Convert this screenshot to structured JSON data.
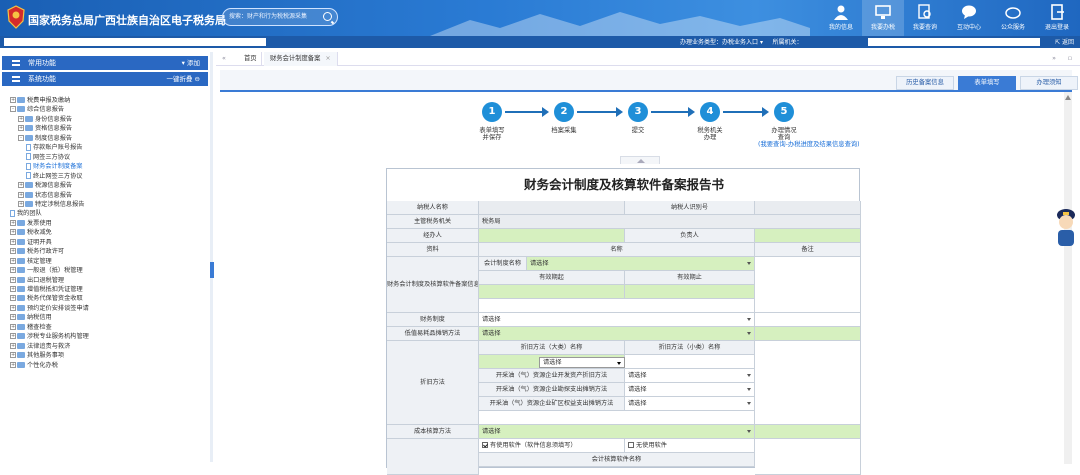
{
  "header": {
    "title": "国家税务总局广西壮族自治区电子税务局",
    "search_placeholder": "搜索：财产和行为税税源采集",
    "nav": [
      "我的信息",
      "我要办税",
      "我要查询",
      "互动中心",
      "公众服务",
      "退出登录"
    ]
  },
  "bar2": {
    "business_type_label": "办理业务类型：",
    "business_type_value": "办税业务入口",
    "agency_label": "所属机关：",
    "back": "返回"
  },
  "sidebar": {
    "common": "常用功能",
    "common_action": "添加",
    "all": "系统功能",
    "all_action": "一键折叠",
    "tree": [
      {
        "l": "税费申报及缴纳",
        "pm": "+",
        "d": 0
      },
      {
        "l": "综合信息报告",
        "pm": "-",
        "d": 0
      },
      {
        "l": "身份信息报告",
        "pm": "+",
        "d": 1
      },
      {
        "l": "资格信息报告",
        "pm": "+",
        "d": 1
      },
      {
        "l": "制度信息报告",
        "pm": "-",
        "d": 1
      },
      {
        "l": "存款账户账号报告",
        "pm": "",
        "d": 2
      },
      {
        "l": "网签三方协议",
        "pm": "",
        "d": 2
      },
      {
        "l": "财务会计制度备案",
        "pm": "",
        "d": 2,
        "sel": true
      },
      {
        "l": "终止网签三方协议",
        "pm": "",
        "d": 2
      },
      {
        "l": "税源信息报告",
        "pm": "+",
        "d": 1
      },
      {
        "l": "状态信息报告",
        "pm": "+",
        "d": 1
      },
      {
        "l": "特定涉税信息报告",
        "pm": "+",
        "d": 1
      },
      {
        "l": "我的团队",
        "pm": "",
        "d": 0
      },
      {
        "l": "发票使用",
        "pm": "+",
        "d": 0
      },
      {
        "l": "税收减免",
        "pm": "+",
        "d": 0
      },
      {
        "l": "证明开具",
        "pm": "+",
        "d": 0
      },
      {
        "l": "税务行政许可",
        "pm": "+",
        "d": 0
      },
      {
        "l": "核定管理",
        "pm": "+",
        "d": 0
      },
      {
        "l": "一般退（抵）税管理",
        "pm": "+",
        "d": 0
      },
      {
        "l": "出口退税管理",
        "pm": "+",
        "d": 0
      },
      {
        "l": "增值税抵扣凭证管理",
        "pm": "+",
        "d": 0
      },
      {
        "l": "税务代保管资金收取",
        "pm": "+",
        "d": 0
      },
      {
        "l": "预约定价安排谈签申请",
        "pm": "+",
        "d": 0
      },
      {
        "l": "纳税信用",
        "pm": "+",
        "d": 0
      },
      {
        "l": "稽查检查",
        "pm": "+",
        "d": 0
      },
      {
        "l": "涉税专业服务机构管理",
        "pm": "+",
        "d": 0
      },
      {
        "l": "法律追责与救济",
        "pm": "+",
        "d": 0
      },
      {
        "l": "其他服务事项",
        "pm": "+",
        "d": 0
      },
      {
        "l": "个性化办税",
        "pm": "+",
        "d": 0
      }
    ]
  },
  "tabs": {
    "home": "首页",
    "current": "财务会计制度备案"
  },
  "subtabs": [
    "历史备案信息",
    "表单填写",
    "办理须知"
  ],
  "steps": [
    {
      "n": "1",
      "label": "表单填写\n并保存"
    },
    {
      "n": "2",
      "label": "档案采集"
    },
    {
      "n": "3",
      "label": "提交"
    },
    {
      "n": "4",
      "label": "税务机关\n办理"
    },
    {
      "n": "5",
      "label": "办理情况\n查询"
    }
  ],
  "step5_link": "(我要查询-办税进度及结果信息查询)",
  "form": {
    "title": "财务会计制度及核算软件备案报告书",
    "taxpayer_name": "纳税人名称",
    "taxpayer_id": "纳税人识别号",
    "authority": "主管税务机关",
    "authority_value": "税务局",
    "handler": "经办人",
    "responsible": "负责人",
    "material": "资料",
    "name_col": "名称",
    "remark": "备注",
    "acct_info": "财务会计制度及核算软件备案信息",
    "acct_system_name": "会计制度名称",
    "select": "请选择",
    "valid_from": "有效期起",
    "valid_to": "有效期止",
    "fin_system": "财务制度",
    "low_value": "低值易耗品摊销方法",
    "depr": "折旧方法",
    "depr_big": "折旧方法（大类）名称",
    "depr_small": "折旧方法（小类）名称",
    "mining1": "开采油（气）资源企业开发资产折旧方法",
    "mining2": "开采油（气）资源企业勘探支出摊销方法",
    "mining3": "开采油（气）资源企业矿区权益支出摊销方法",
    "cost": "成本核算方法",
    "use_sw": "有使用软件（软件信息须填写）",
    "no_sw": "无使用软件",
    "sw_name": "会计核算软件名称"
  }
}
